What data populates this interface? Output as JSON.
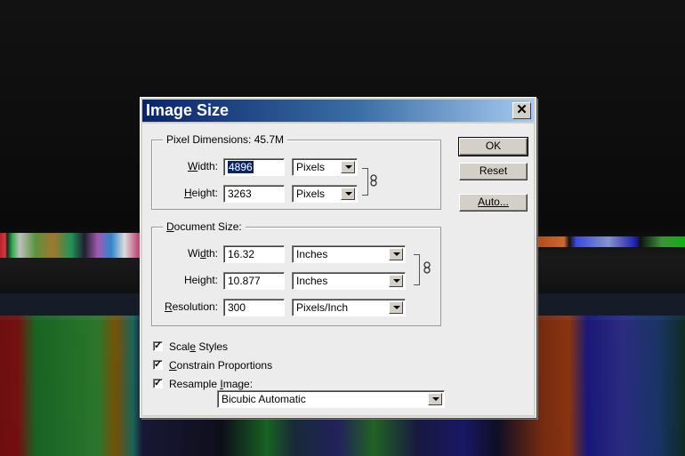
{
  "dialog": {
    "title": "Image Size",
    "close_glyph": "✕"
  },
  "pixel_dimensions": {
    "legend": "Pixel Dimensions:  45.7M",
    "width_label_prefix": "",
    "width_label_u": "W",
    "width_label_rest": "idth:",
    "width_value": "4896",
    "width_unit": "Pixels",
    "height_label_u": "H",
    "height_label_rest": "eight:",
    "height_value": "3263",
    "height_unit": "Pixels"
  },
  "document_size": {
    "legend_u": "D",
    "legend_rest": "ocument Size:",
    "width_label_pre": "Wi",
    "width_label_u": "d",
    "width_label_rest": "th:",
    "width_value": "16.32",
    "width_unit": "Inches",
    "height_label_pre": "Hei",
    "height_label_u": "g",
    "height_label_rest": "ht:",
    "height_value": "10.877",
    "height_unit": "Inches",
    "resolution_label_u": "R",
    "resolution_label_rest": "esolution:",
    "resolution_value": "300",
    "resolution_unit": "Pixels/Inch"
  },
  "options": {
    "scale_styles_pre": "Scal",
    "scale_styles_u": "e",
    "scale_styles_rest": " Styles",
    "constrain_u": "C",
    "constrain_rest": "onstrain Proportions",
    "resample_pre": "Resample ",
    "resample_u": "I",
    "resample_rest": "mage:",
    "check_glyph": "✓",
    "scale_styles_checked": true,
    "constrain_checked": true,
    "resample_checked": true,
    "resample_method": "Bicubic Automatic"
  },
  "buttons": {
    "ok": "OK",
    "reset": "Reset",
    "auto": "Auto..."
  }
}
